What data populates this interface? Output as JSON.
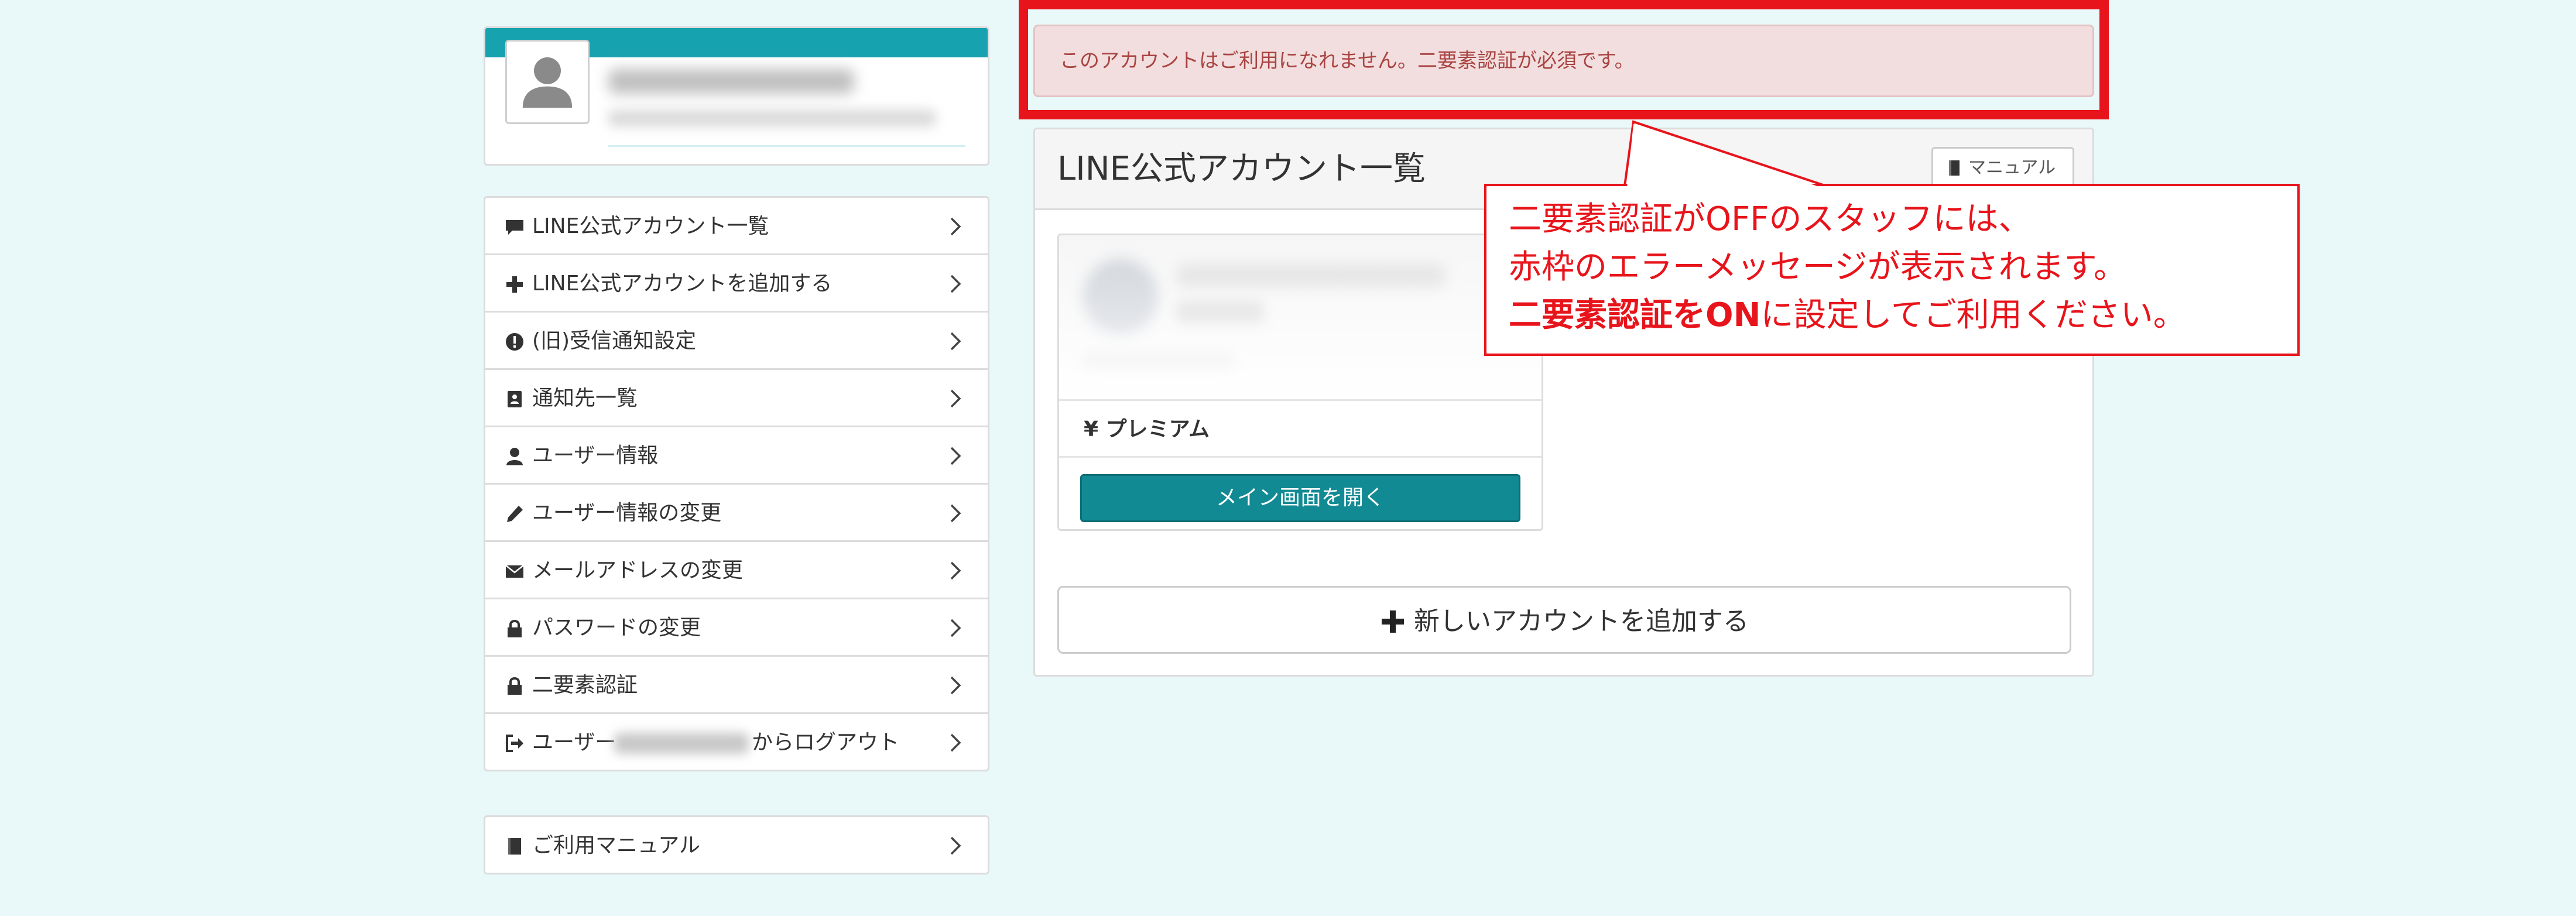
{
  "alert": {
    "message": "このアカウントはご利用になれません。二要素認証が必須です。"
  },
  "sidebar": {
    "items": [
      {
        "label": "LINE公式アカウント一覧",
        "icon": "comment-icon"
      },
      {
        "label": "LINE公式アカウントを追加する",
        "icon": "plus-icon"
      },
      {
        "label": "(旧)受信通知設定",
        "icon": "exclamation-circle-icon"
      },
      {
        "label": "通知先一覧",
        "icon": "contact-book-icon"
      },
      {
        "label": "ユーザー情報",
        "icon": "user-icon"
      },
      {
        "label": "ユーザー情報の変更",
        "icon": "pencil-icon"
      },
      {
        "label": "メールアドレスの変更",
        "icon": "envelope-icon"
      },
      {
        "label": "パスワードの変更",
        "icon": "lock-icon"
      },
      {
        "label": "二要素認証",
        "icon": "lock-icon"
      }
    ],
    "logout": {
      "prefix": "ユーザー",
      "suffix": "からログアウト",
      "icon": "logout-icon"
    },
    "manual": {
      "label": "ご利用マニュアル",
      "icon": "book-icon"
    }
  },
  "main": {
    "title": "LINE公式アカウント一覧",
    "manual_button": "マニュアル",
    "account": {
      "plan_label": "¥ プレミアム",
      "open_button": "メイン画面を開く"
    },
    "add_button": "新しいアカウントを追加する"
  },
  "callout": {
    "line1": "二要素認証がOFFのスタッフには、",
    "line2": "赤枠のエラーメッセージが表示されます。",
    "line3_bold": "二要素認証をON",
    "line3_rest": "に設定してご利用ください。"
  },
  "colors": {
    "background": "#e9f8f9",
    "teal": "#17a2b0",
    "button": "#128a93",
    "highlight_red": "#e8141b",
    "alert_bg": "#f2dede",
    "alert_text": "#a94442"
  }
}
